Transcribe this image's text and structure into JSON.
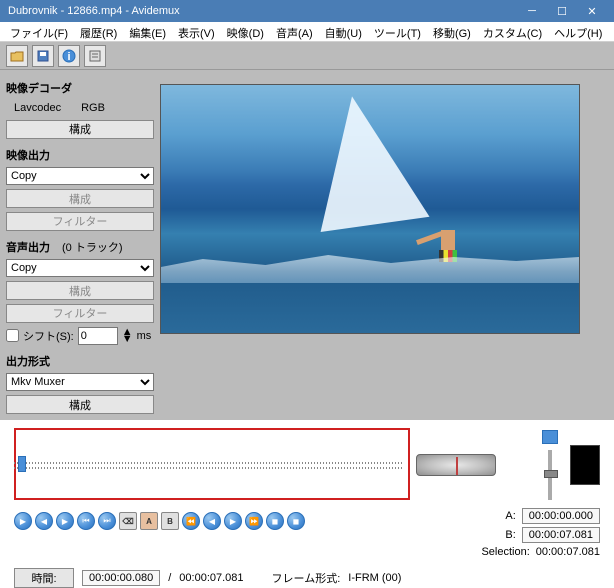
{
  "title": "Dubrovnik - 12866.mp4 - Avidemux",
  "menu": [
    "ファイル(F)",
    "履歴(R)",
    "編集(E)",
    "表示(V)",
    "映像(D)",
    "音声(A)",
    "自動(U)",
    "ツール(T)",
    "移動(G)",
    "カスタム(C)",
    "ヘルプ(H)"
  ],
  "sidebar": {
    "decoder": {
      "label": "映像デコーダ",
      "codec": "Lavcodec",
      "mode": "RGB",
      "config": "構成"
    },
    "videoOut": {
      "label": "映像出力",
      "value": "Copy",
      "config": "構成",
      "filter": "フィルター"
    },
    "audioOut": {
      "label": "音声出力",
      "tracks": "(0 トラック)",
      "value": "Copy",
      "config": "構成",
      "filter": "フィルター"
    },
    "shift": {
      "label": "シフト(S):",
      "value": "0",
      "unit": "ms"
    },
    "outFormat": {
      "label": "出力形式",
      "value": "Mkv Muxer",
      "config": "構成"
    }
  },
  "ab": {
    "aLabel": "A:",
    "a": "00:00:00.000",
    "bLabel": "B:",
    "b": "00:00:07.081",
    "selLabel": "Selection:",
    "sel": "00:00:07.081"
  },
  "status": {
    "timeLabel": "時間:",
    "time": "00:00:00.080",
    "durPrefix": "/",
    "dur": "00:00:07.081",
    "frameTypeLabel": "フレーム形式:",
    "frameType": "I-FRM (00)"
  }
}
